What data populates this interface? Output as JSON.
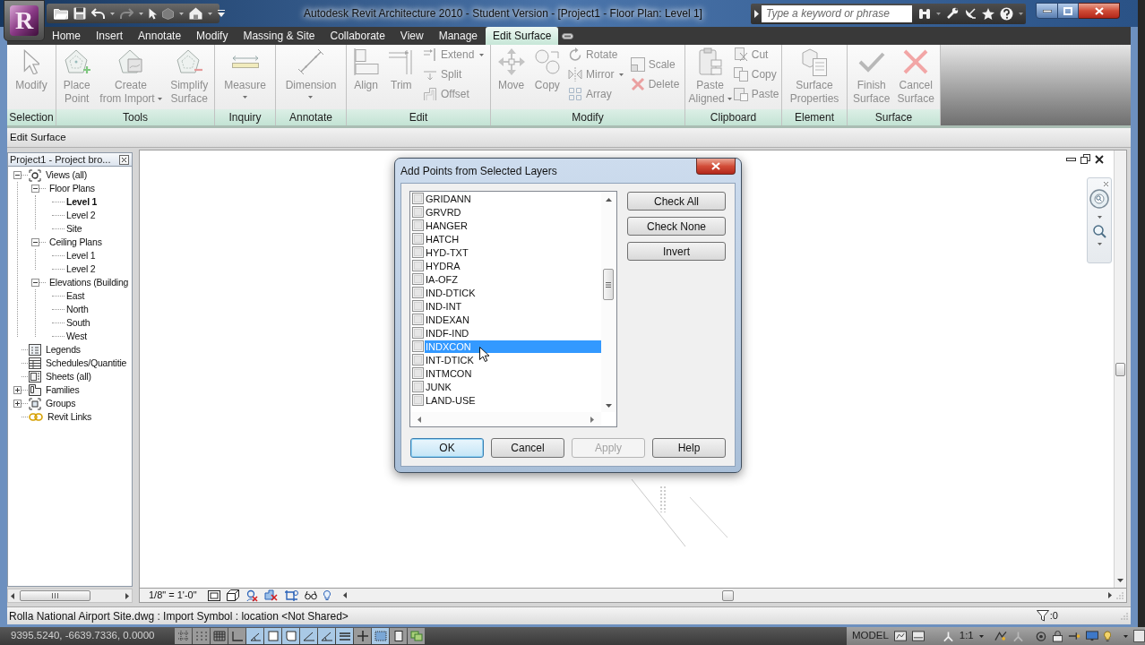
{
  "window": {
    "title": "Autodesk Revit Architecture 2010 - Student Version - [Project1 - Floor Plan: Level 1]",
    "app_letter": "R"
  },
  "search": {
    "placeholder": "Type a keyword or phrase"
  },
  "ribbon_tabs": [
    {
      "label": "Home",
      "selected": false
    },
    {
      "label": "Insert",
      "selected": false
    },
    {
      "label": "Annotate",
      "selected": false
    },
    {
      "label": "Modify",
      "selected": false
    },
    {
      "label": "Massing & Site",
      "selected": false
    },
    {
      "label": "Collaborate",
      "selected": false
    },
    {
      "label": "View",
      "selected": false
    },
    {
      "label": "Manage",
      "selected": false
    },
    {
      "label": "Edit Surface",
      "selected": true
    }
  ],
  "ribbon_panels": [
    {
      "label": "Selection",
      "items": [
        {
          "kind": "large",
          "lines": [
            "Modify"
          ],
          "disabled": true,
          "dropdown": false
        }
      ]
    },
    {
      "label": "Tools",
      "items": [
        {
          "kind": "large",
          "lines": [
            "Place",
            "Point"
          ],
          "disabled": true,
          "dropdown": false
        },
        {
          "kind": "large",
          "lines": [
            "Create",
            "from Import"
          ],
          "disabled": true,
          "dropdown": true
        },
        {
          "kind": "large",
          "lines": [
            "Simplify",
            "Surface"
          ],
          "disabled": true,
          "dropdown": false
        }
      ]
    },
    {
      "label": "Inquiry",
      "items": [
        {
          "kind": "large",
          "lines": [
            "Measure"
          ],
          "disabled": true,
          "dropdown": true
        }
      ]
    },
    {
      "label": "Annotate",
      "items": [
        {
          "kind": "large",
          "lines": [
            "Dimension"
          ],
          "disabled": true,
          "dropdown": true
        }
      ]
    },
    {
      "label": "Edit",
      "items": [
        {
          "kind": "large",
          "lines": [
            "Align"
          ],
          "disabled": true,
          "dropdown": false
        },
        {
          "kind": "large",
          "lines": [
            "Trim"
          ],
          "disabled": true,
          "dropdown": false
        },
        {
          "kind": "stack",
          "tools": [
            {
              "label": "Extend",
              "disabled": true,
              "dropdown": true
            },
            {
              "label": "Split",
              "disabled": true,
              "dropdown": false
            },
            {
              "label": "Offset",
              "disabled": true,
              "dropdown": false
            }
          ]
        }
      ]
    },
    {
      "label": "Modify",
      "items": [
        {
          "kind": "large",
          "lines": [
            "Move"
          ],
          "disabled": true,
          "dropdown": false
        },
        {
          "kind": "large",
          "lines": [
            "Copy"
          ],
          "disabled": true,
          "dropdown": false
        },
        {
          "kind": "stack",
          "tools": [
            {
              "label": "Rotate",
              "disabled": true,
              "dropdown": false
            },
            {
              "label": "Mirror",
              "disabled": true,
              "dropdown": true
            },
            {
              "label": "Array",
              "disabled": true,
              "dropdown": false
            }
          ]
        },
        {
          "kind": "stack",
          "tools": [
            {
              "label": "Scale",
              "disabled": true,
              "dropdown": false
            },
            {
              "label": "Delete",
              "disabled": true,
              "dropdown": false
            }
          ]
        }
      ]
    },
    {
      "label": "Clipboard",
      "items": [
        {
          "kind": "large",
          "lines": [
            "Paste",
            "Aligned"
          ],
          "disabled": true,
          "dropdown": true
        },
        {
          "kind": "stack",
          "tools": [
            {
              "label": "Cut",
              "disabled": true,
              "dropdown": false
            },
            {
              "label": "Copy",
              "disabled": true,
              "dropdown": false
            },
            {
              "label": "Paste",
              "disabled": true,
              "dropdown": false
            }
          ]
        }
      ]
    },
    {
      "label": "Element",
      "items": [
        {
          "kind": "large",
          "lines": [
            "Surface",
            "Properties"
          ],
          "disabled": true,
          "dropdown": false
        }
      ]
    },
    {
      "label": "Surface",
      "items": [
        {
          "kind": "large",
          "lines": [
            "Finish",
            "Surface"
          ],
          "disabled": true,
          "dropdown": false
        },
        {
          "kind": "large",
          "lines": [
            "Cancel",
            "Surface"
          ],
          "disabled": true,
          "dropdown": false
        }
      ]
    }
  ],
  "options_bar": {
    "label": "Edit Surface"
  },
  "project_browser": {
    "title": "Project1 - Project bro...",
    "tree": [
      {
        "label": "Views (all)",
        "expanded": true,
        "current": false,
        "children": [
          {
            "label": "Floor Plans",
            "expanded": true,
            "current": false,
            "children": [
              {
                "label": "Level 1",
                "current": true
              },
              {
                "label": "Level 2",
                "current": false
              },
              {
                "label": "Site",
                "current": false
              }
            ]
          },
          {
            "label": "Ceiling Plans",
            "expanded": true,
            "current": false,
            "children": [
              {
                "label": "Level 1",
                "current": false
              },
              {
                "label": "Level 2",
                "current": false
              }
            ]
          },
          {
            "label": "Elevations (Building",
            "expanded": true,
            "current": false,
            "children": [
              {
                "label": "East",
                "current": false
              },
              {
                "label": "North",
                "current": false
              },
              {
                "label": "South",
                "current": false
              },
              {
                "label": "West",
                "current": false
              }
            ]
          }
        ]
      },
      {
        "label": "Legends",
        "current": false
      },
      {
        "label": "Schedules/Quantitie",
        "current": false
      },
      {
        "label": "Sheets (all)",
        "current": false
      },
      {
        "label": "Families",
        "expanded": false,
        "current": false
      },
      {
        "label": "Groups",
        "expanded": false,
        "current": false
      },
      {
        "label": "Revit Links",
        "current": false
      }
    ]
  },
  "view_control_bar": {
    "scale": "1/8\" = 1'-0\""
  },
  "dialog": {
    "title": "Add Points from Selected Layers",
    "layers": [
      {
        "name": "GRIDANN",
        "checked": false,
        "selected": false
      },
      {
        "name": "GRVRD",
        "checked": false,
        "selected": false
      },
      {
        "name": "HANGER",
        "checked": false,
        "selected": false
      },
      {
        "name": "HATCH",
        "checked": false,
        "selected": false
      },
      {
        "name": "HYD-TXT",
        "checked": false,
        "selected": false
      },
      {
        "name": "HYDRA",
        "checked": false,
        "selected": false
      },
      {
        "name": "IA-OFZ",
        "checked": false,
        "selected": false
      },
      {
        "name": "IND-DTICK",
        "checked": false,
        "selected": false
      },
      {
        "name": "IND-INT",
        "checked": false,
        "selected": false
      },
      {
        "name": "INDEXAN",
        "checked": false,
        "selected": false
      },
      {
        "name": "INDF-IND",
        "checked": false,
        "selected": false
      },
      {
        "name": "INDXCON",
        "checked": false,
        "selected": true
      },
      {
        "name": "INT-DTICK",
        "checked": false,
        "selected": false
      },
      {
        "name": "INTMCON",
        "checked": false,
        "selected": false
      },
      {
        "name": "JUNK",
        "checked": false,
        "selected": false
      },
      {
        "name": "LAND-USE",
        "checked": false,
        "selected": false
      }
    ],
    "side_buttons": [
      "Check All",
      "Check None",
      "Invert"
    ],
    "buttons": [
      {
        "label": "OK",
        "default": true,
        "disabled": false
      },
      {
        "label": "Cancel",
        "default": false,
        "disabled": false
      },
      {
        "label": "Apply",
        "default": false,
        "disabled": true
      },
      {
        "label": "Help",
        "default": false,
        "disabled": false
      }
    ]
  },
  "status_bar": {
    "text": "Rolla National Airport Site.dwg : Import Symbol : location <Not Shared>",
    "selection_count": ":0"
  },
  "background_app": {
    "coordinates": "9395.5240, -6639.7336, 0.0000",
    "toggles": [
      {
        "on": false
      },
      {
        "on": false
      },
      {
        "on": false
      },
      {
        "on": false
      },
      {
        "on": true
      },
      {
        "on": true
      },
      {
        "on": true
      },
      {
        "on": true
      },
      {
        "on": true
      },
      {
        "on": true
      },
      {
        "on": false
      },
      {
        "on": true
      },
      {
        "on": false
      },
      {
        "on": false
      }
    ],
    "space": "MODEL",
    "scale": "1:1"
  }
}
